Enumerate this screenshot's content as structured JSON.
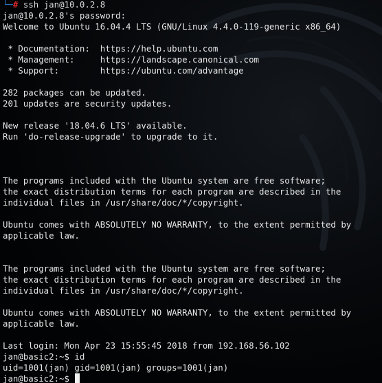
{
  "terminal": {
    "prompt_prefix": "└─",
    "prompt_hash": "#",
    "first_command": "ssh jan@10.0.2.8",
    "lines": [
      "jan@10.0.2.8's password:",
      "Welcome to Ubuntu 16.04.4 LTS (GNU/Linux 4.4.0-119-generic x86_64)",
      "",
      " * Documentation:  https://help.ubuntu.com",
      " * Management:     https://landscape.canonical.com",
      " * Support:        https://ubuntu.com/advantage",
      "",
      "282 packages can be updated.",
      "201 updates are security updates.",
      "",
      "New release '18.04.6 LTS' available.",
      "Run 'do-release-upgrade' to upgrade to it.",
      "",
      "",
      "",
      "The programs included with the Ubuntu system are free software;",
      "the exact distribution terms for each program are described in the",
      "individual files in /usr/share/doc/*/copyright.",
      "",
      "Ubuntu comes with ABSOLUTELY NO WARRANTY, to the extent permitted by",
      "applicable law.",
      "",
      "",
      "The programs included with the Ubuntu system are free software;",
      "the exact distribution terms for each program are described in the",
      "individual files in /usr/share/doc/*/copyright.",
      "",
      "Ubuntu comes with ABSOLUTELY NO WARRANTY, to the extent permitted by",
      "applicable law.",
      "",
      "Last login: Mon Apr 23 15:55:45 2018 from 192.168.56.102",
      "jan@basic2:~$ id",
      "uid=1001(jan) gid=1001(jan) groups=1001(jan)"
    ],
    "current_prompt": "jan@basic2:~$ ",
    "cursor": "block"
  },
  "colors": {
    "background": "#050709",
    "text": "#e6e6e6",
    "prompt_corner": "#2f7fd1",
    "prompt_hash": "#e02b2b"
  }
}
